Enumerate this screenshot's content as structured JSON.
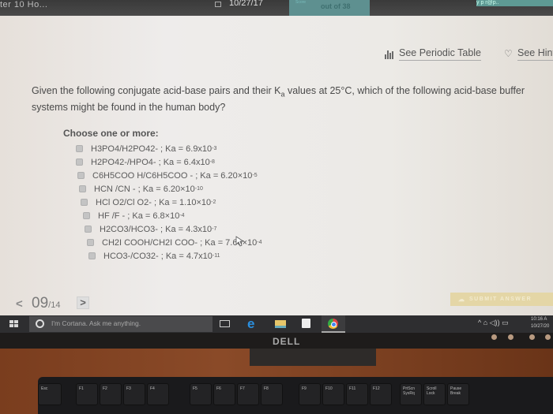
{
  "topbar": {
    "breadcrumb": "ter 10 Ho...",
    "date": "10/27/17",
    "score_label": "Score",
    "score_text": "out of 38",
    "user": "y  p  r@p.."
  },
  "links": {
    "periodic_table": "See Periodic Table",
    "hint": "See Hint"
  },
  "question": {
    "text_before": "Given the following conjugate acid-base pairs and their K",
    "subscript": "a",
    "text_after": " values at 25°C, which of the following acid-base buffer systems might be found in the human body?",
    "instruction": "Choose one or more:"
  },
  "options": [
    {
      "pair": "H3PO4/H2PO42- ; Ka = 6.9x10",
      "exp": "-3",
      "checked": false
    },
    {
      "pair": "H2PO42-/HPO4- ; Ka = 6.4x10",
      "exp": "-8",
      "checked": false
    },
    {
      "pair": "C6H5COO H/C6H5COO - ; Ka = 6.20×10",
      "exp": "-5",
      "checked": false
    },
    {
      "pair": "HCN /CN - ; Ka = 6.20×10",
      "exp": "-10",
      "checked": false
    },
    {
      "pair": "HCl O2/Cl O2- ; Ka = 1.10×10",
      "exp": "-2",
      "checked": false
    },
    {
      "pair": "HF /F - ; Ka = 6.8×10",
      "exp": "-4",
      "checked": false
    },
    {
      "pair": "H2CO3/HCO3- ; Ka = 4.3x10",
      "exp": "-7",
      "checked": false
    },
    {
      "pair": "CH2I COOH/CH2I COO- ; Ka = 7.60×10",
      "exp": "-4",
      "checked": false
    },
    {
      "pair": "HCO3-/CO32- ; Ka = 4.7x10",
      "exp": "-11",
      "checked": false
    }
  ],
  "nav": {
    "current": "09",
    "total": "/14",
    "prev_glyph": "<",
    "next_glyph": ">"
  },
  "submit": {
    "label": "SUBMIT ANSWER",
    "icon": "upload-cloud-icon"
  },
  "taskbar": {
    "cortana_placeholder": "I'm Cortana. Ask me anything.",
    "time": "10:16 A",
    "date": "10/27/20",
    "tray": "^  ⌂ ◁)) ▭"
  },
  "monitor": {
    "brand": "DELL"
  },
  "keyboard": {
    "keys": [
      "Esc",
      "F1",
      "F2",
      "F3",
      "F4",
      "F5",
      "F6",
      "F7",
      "F8",
      "F9",
      "F10",
      "F11",
      "F12",
      "PrtScn SysRq",
      "Scroll Lock",
      "Pause Break"
    ]
  }
}
